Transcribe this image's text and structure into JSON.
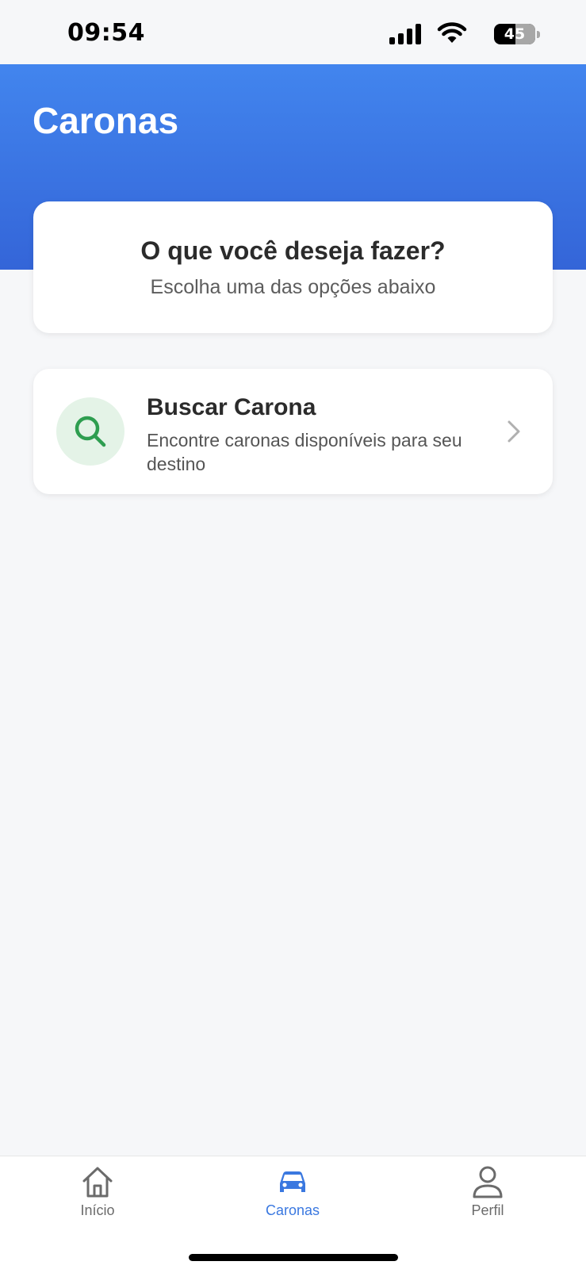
{
  "status_bar": {
    "time": "09:54",
    "battery": "45"
  },
  "header": {
    "title": "Caronas"
  },
  "question_card": {
    "title": "O que você deseja fazer?",
    "subtitle": "Escolha uma das opções abaixo"
  },
  "options": [
    {
      "title": "Buscar Carona",
      "description": "Encontre caronas disponíveis para seu destino",
      "icon": "search-icon"
    }
  ],
  "tab_bar": {
    "tabs": [
      {
        "label": "Início",
        "icon": "home-icon",
        "active": false
      },
      {
        "label": "Caronas",
        "icon": "car-icon",
        "active": true
      },
      {
        "label": "Perfil",
        "icon": "person-icon",
        "active": false
      }
    ]
  },
  "colors": {
    "header_gradient_top": "#4285ee",
    "header_gradient_bottom": "#3465d8",
    "accent_green": "#2e9e50",
    "active_tab": "#3a78e0",
    "inactive_tab": "#6b6b6b"
  }
}
